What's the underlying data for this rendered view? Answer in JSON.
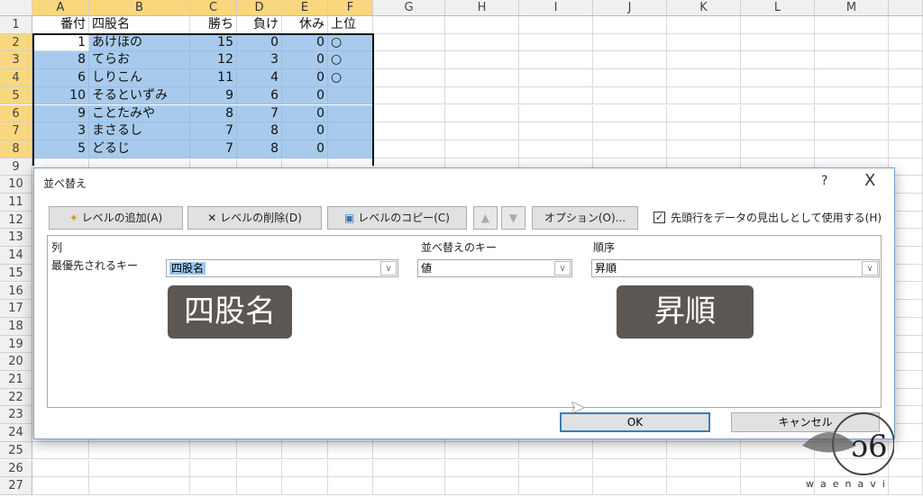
{
  "sheet": {
    "columns": [
      "A",
      "B",
      "C",
      "D",
      "E",
      "F",
      "G",
      "H",
      "I",
      "J",
      "K",
      "L",
      "M"
    ],
    "headers": [
      "番付",
      "四股名",
      "勝ち",
      "負け",
      "休み",
      "上位"
    ],
    "rows": [
      [
        "1",
        "あけほの",
        "15",
        "0",
        "0",
        "○"
      ],
      [
        "8",
        "てらお",
        "12",
        "3",
        "0",
        "○"
      ],
      [
        "6",
        "しりこん",
        "11",
        "4",
        "0",
        "○"
      ],
      [
        "10",
        "そるといずみ",
        "9",
        "6",
        "0",
        ""
      ],
      [
        "9",
        "ことたみや",
        "8",
        "7",
        "0",
        ""
      ],
      [
        "3",
        "まさるし",
        "7",
        "8",
        "0",
        ""
      ],
      [
        "5",
        "どるじ",
        "7",
        "8",
        "0",
        ""
      ]
    ],
    "row_numbers": [
      "1",
      "2",
      "3",
      "4",
      "5",
      "6",
      "7",
      "8",
      "9",
      "10",
      "11",
      "12",
      "13",
      "14",
      "15",
      "16",
      "17",
      "18",
      "19",
      "20",
      "21",
      "22",
      "23",
      "24",
      "25",
      "26",
      "27"
    ]
  },
  "dialog": {
    "title": "並べ替え",
    "help": "?",
    "close": "X",
    "toolbar": {
      "add": "レベルの追加(A)",
      "delete": "レベルの削除(D)",
      "copy": "レベルのコピー(C)",
      "up": "▲",
      "down": "▼",
      "options": "オプション(O)...",
      "header_checkbox": "先頭行をデータの見出しとして使用する(H)",
      "header_checked": true
    },
    "list": {
      "col_header": "列",
      "key_header": "並べ替えのキー",
      "order_header": "順序",
      "row_label": "最優先されるキー",
      "column_value": "四股名",
      "key_value": "値",
      "order_value": "昇順"
    },
    "ok": "OK",
    "cancel": "キャンセル"
  },
  "overlays": {
    "left": "四股名",
    "right": "昇順"
  },
  "watermark": "waenavi"
}
